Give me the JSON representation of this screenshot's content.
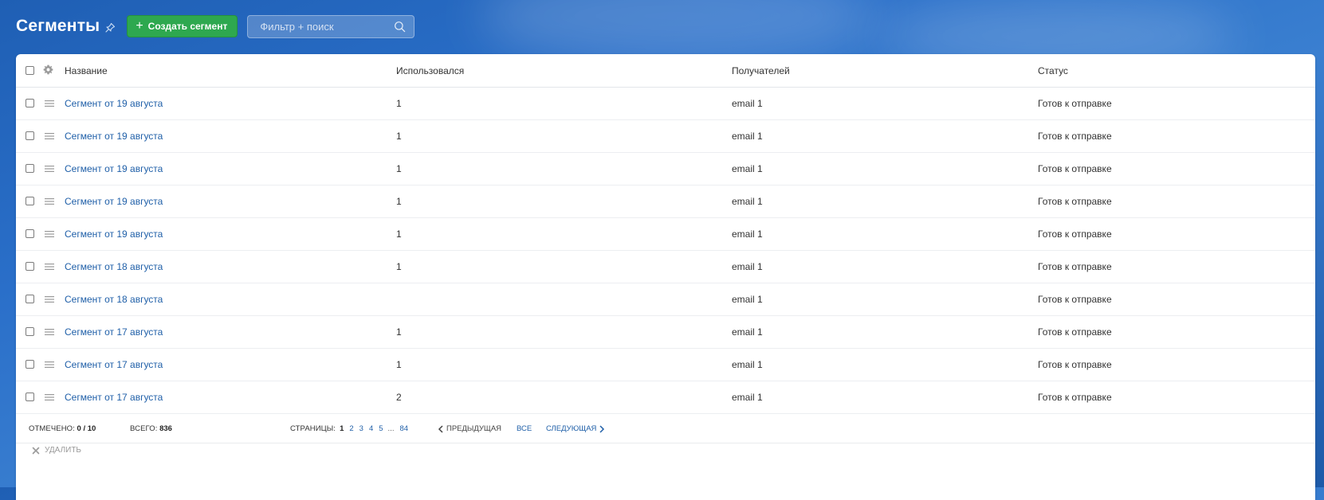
{
  "header": {
    "title": "Сегменты",
    "create_label": "Создать сегмент",
    "search_placeholder": "Фильтр + поиск"
  },
  "table": {
    "columns": {
      "name": "Название",
      "used": "Использовался",
      "recipients": "Получателей",
      "status": "Статус"
    },
    "rows": [
      {
        "name": "Сегмент от 19 августа",
        "used": "1",
        "recipients": "email 1",
        "status": "Готов к отправке"
      },
      {
        "name": "Сегмент от 19 августа",
        "used": "1",
        "recipients": "email 1",
        "status": "Готов к отправке"
      },
      {
        "name": "Сегмент от 19 августа",
        "used": "1",
        "recipients": "email 1",
        "status": "Готов к отправке"
      },
      {
        "name": "Сегмент от 19 августа",
        "used": "1",
        "recipients": "email 1",
        "status": "Готов к отправке"
      },
      {
        "name": "Сегмент от 19 августа",
        "used": "1",
        "recipients": "email 1",
        "status": "Готов к отправке"
      },
      {
        "name": "Сегмент от 18 августа",
        "used": "1",
        "recipients": "email 1",
        "status": "Готов к отправке"
      },
      {
        "name": "Сегмент от 18 августа",
        "used": "",
        "recipients": "email 1",
        "status": "Готов к отправке"
      },
      {
        "name": "Сегмент от 17 августа",
        "used": "1",
        "recipients": "email 1",
        "status": "Готов к отправке"
      },
      {
        "name": "Сегмент от 17 августа",
        "used": "1",
        "recipients": "email 1",
        "status": "Готов к отправке"
      },
      {
        "name": "Сегмент от 17 августа",
        "used": "2",
        "recipients": "email 1",
        "status": "Готов к отправке"
      }
    ]
  },
  "footer": {
    "checked_label": "Отмечено:",
    "checked_value": "0 / 10",
    "total_label": "Всего:",
    "total_value": "836",
    "pages_label": "Страницы:",
    "current_page": "1",
    "pages": [
      "2",
      "3",
      "4",
      "5"
    ],
    "ellipsis": "...",
    "last_page": "84",
    "prev_label": "Предыдущая",
    "all_label": "Все",
    "next_label": "Следующая"
  },
  "actions": {
    "delete_label": "Удалить"
  },
  "colors": {
    "accent_green": "#2ea84f",
    "link_blue": "#1f5fa8"
  }
}
